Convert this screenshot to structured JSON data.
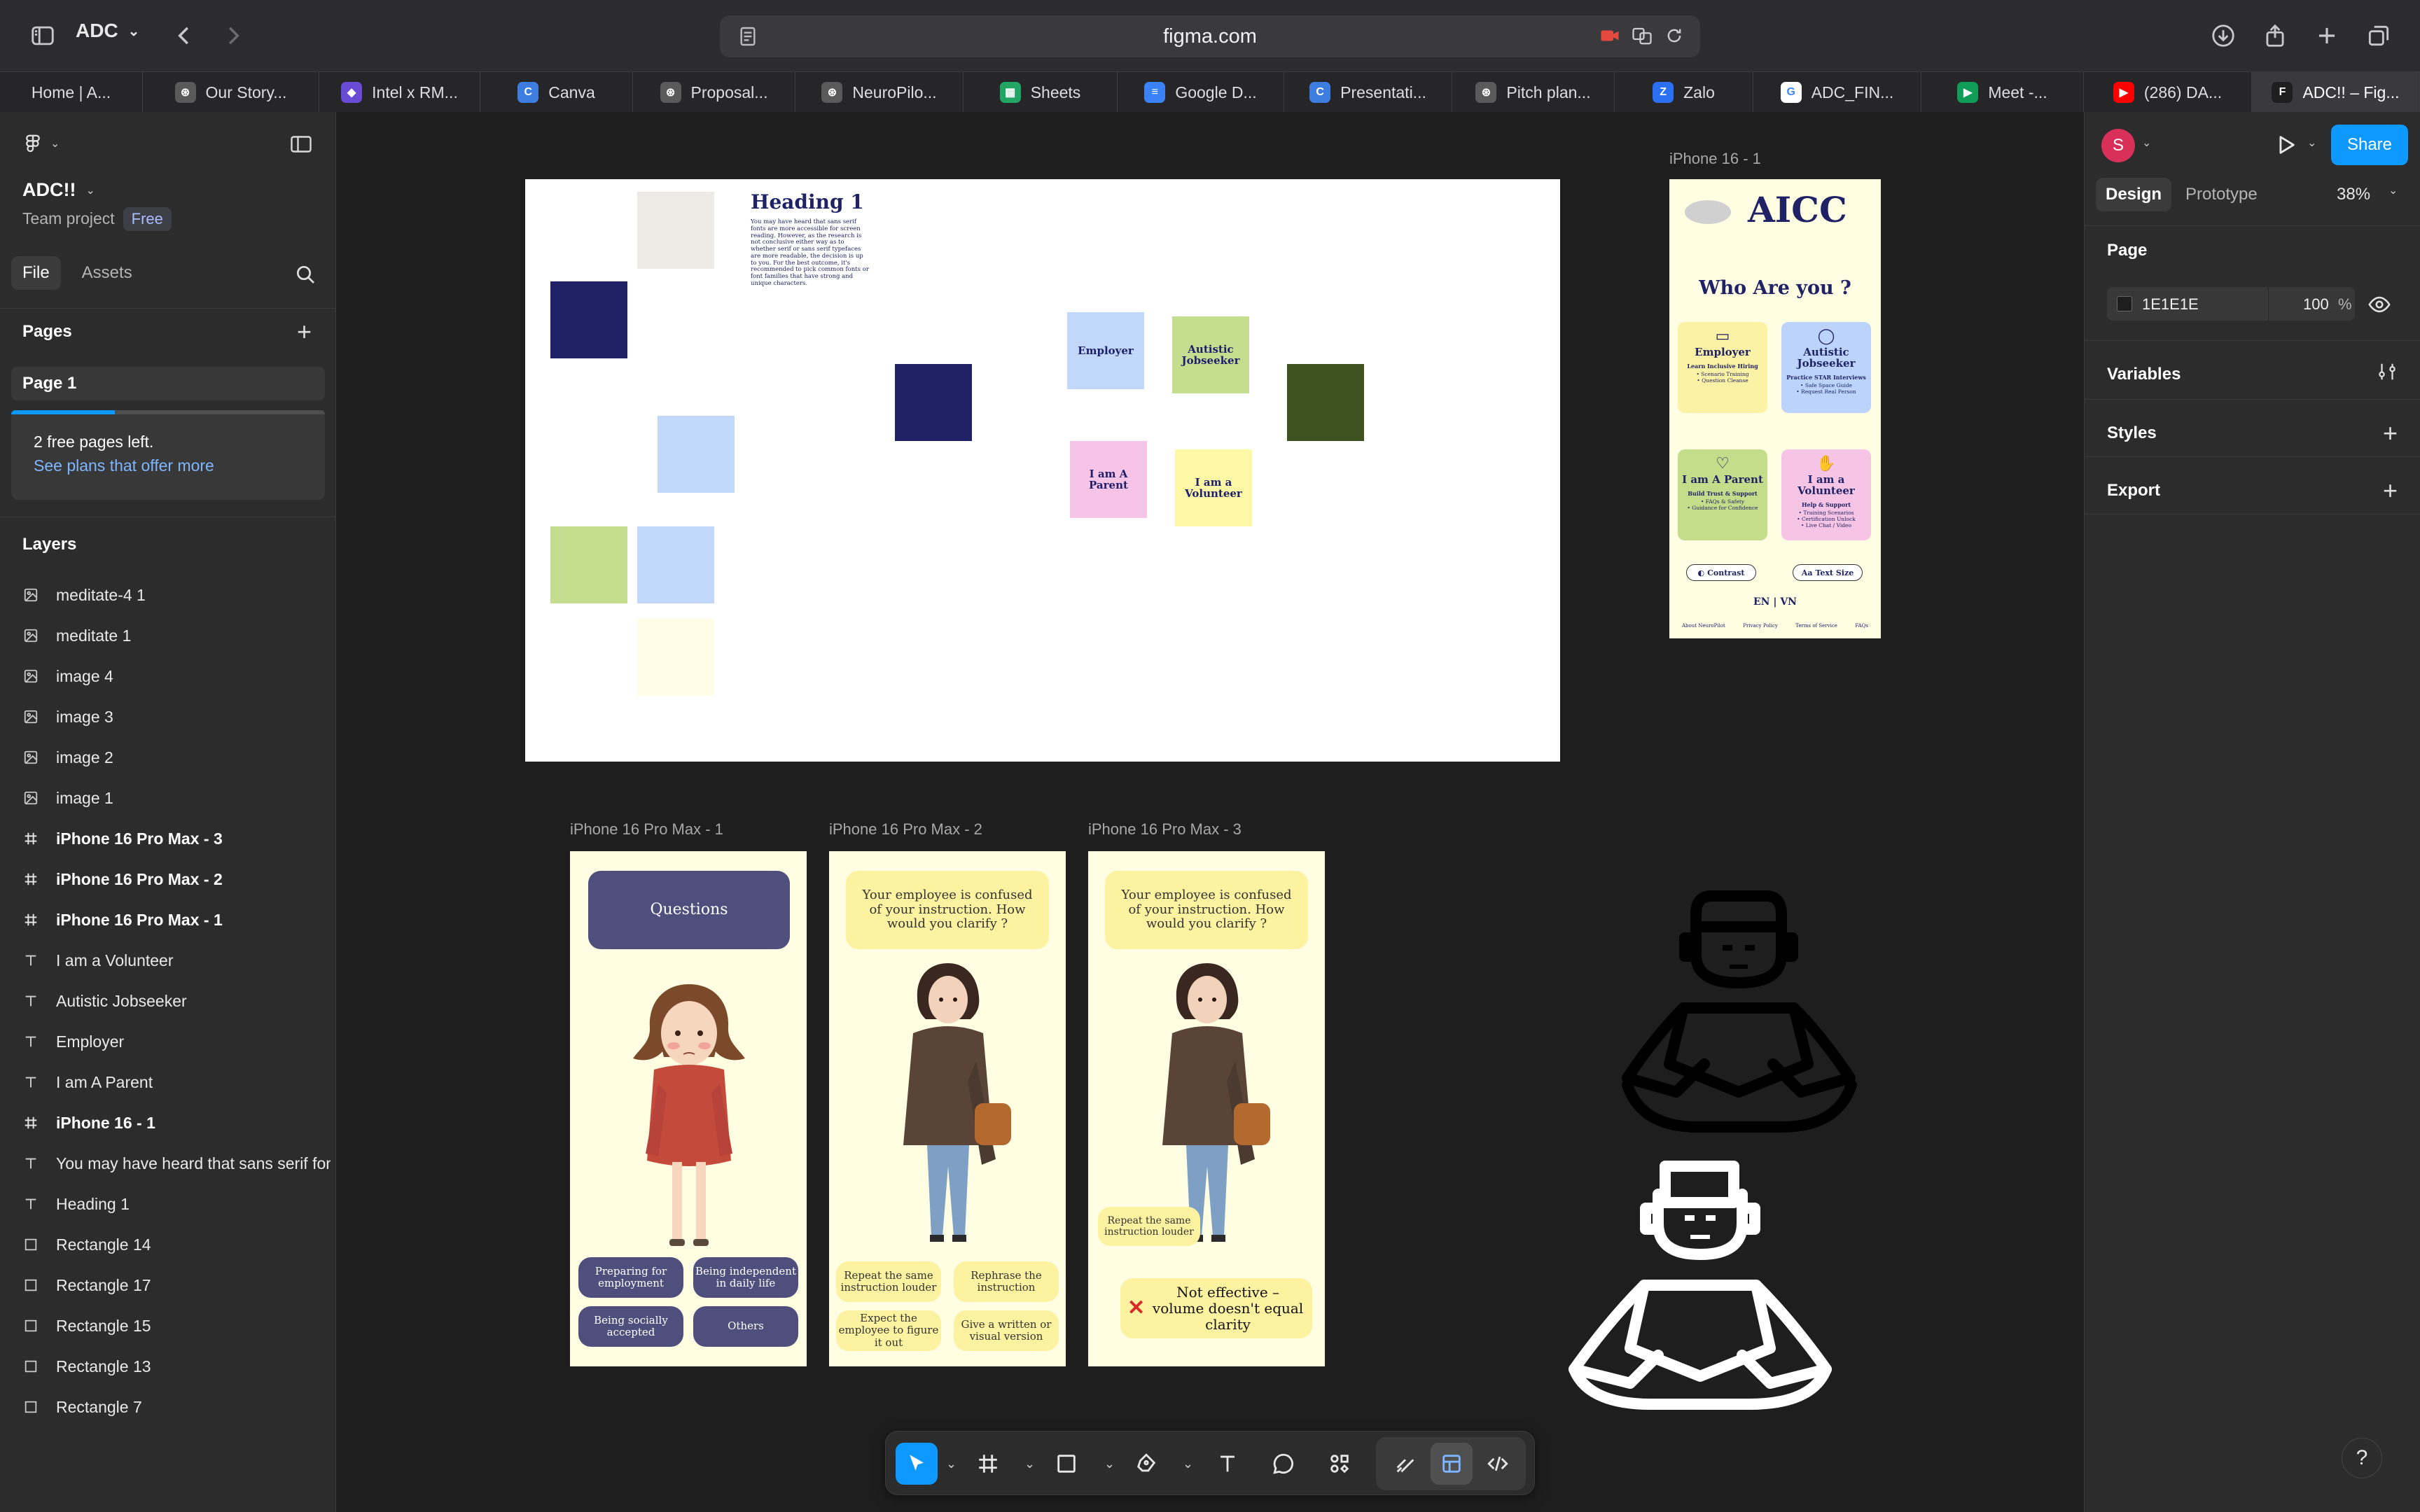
{
  "browser": {
    "profile_label": "ADC",
    "url": "figma.com",
    "tabs": [
      {
        "label": "Home | A...",
        "icon": "none",
        "color": "#3a3a3c",
        "glyph": ""
      },
      {
        "label": "Our Story...",
        "icon": "chatgpt-icon",
        "color": "#5a5a5a",
        "glyph": "⊛"
      },
      {
        "label": "Intel x RM...",
        "icon": "shield-app-icon",
        "color": "#6a4bd6",
        "glyph": "◆"
      },
      {
        "label": "Canva",
        "icon": "canva-icon",
        "color": "#3d7de0",
        "glyph": "C"
      },
      {
        "label": "Proposal...",
        "icon": "chatgpt-icon",
        "color": "#5a5a5a",
        "glyph": "⊛"
      },
      {
        "label": "NeuroPilo...",
        "icon": "chatgpt-icon",
        "color": "#5a5a5a",
        "glyph": "⊛"
      },
      {
        "label": "Sheets",
        "icon": "sheets-icon",
        "color": "#21a464",
        "glyph": "▦"
      },
      {
        "label": "Google D...",
        "icon": "docs-icon",
        "color": "#3b82f6",
        "glyph": "≡"
      },
      {
        "label": "Presentati...",
        "icon": "canva-icon",
        "color": "#3d7de0",
        "glyph": "C"
      },
      {
        "label": "Pitch plan...",
        "icon": "chatgpt-icon",
        "color": "#5a5a5a",
        "glyph": "⊛"
      },
      {
        "label": "Zalo",
        "icon": "zalo-icon",
        "color": "#2b6ff3",
        "glyph": "Z"
      },
      {
        "label": "ADC_FIN...",
        "icon": "google-icon",
        "color": "#ffffff",
        "glyph": "G"
      },
      {
        "label": "Meet -...",
        "icon": "meet-icon",
        "color": "#0f9d58",
        "glyph": "▶"
      },
      {
        "label": "(286) DA...",
        "icon": "youtube-icon",
        "color": "#ff0000",
        "glyph": "▶"
      },
      {
        "label": "ADC!! – Fig...",
        "icon": "figma-icon",
        "color": "#1e1e1e",
        "glyph": "F"
      }
    ]
  },
  "left_panel": {
    "project_name": "ADC!!",
    "team_label": "Team project",
    "plan_badge": "Free",
    "tab_file": "File",
    "tab_assets": "Assets",
    "pages_title": "Pages",
    "current_page": "Page 1",
    "free_pages_text": "2 free pages left.",
    "plans_link": "See plans that offer more",
    "free_pages_used_fraction": 0.33,
    "layers_title": "Layers",
    "layers": [
      {
        "name": "meditate-4 1",
        "type": "image",
        "glyph": "▣",
        "bold": false
      },
      {
        "name": "meditate 1",
        "type": "image",
        "glyph": "▣",
        "bold": false
      },
      {
        "name": "image 4",
        "type": "image",
        "glyph": "▣",
        "bold": false
      },
      {
        "name": "image 3",
        "type": "image",
        "glyph": "▣",
        "bold": false
      },
      {
        "name": "image 2",
        "type": "image",
        "glyph": "▣",
        "bold": false
      },
      {
        "name": "image 1",
        "type": "image",
        "glyph": "▣",
        "bold": false
      },
      {
        "name": "iPhone 16 Pro Max - 3",
        "type": "frame",
        "glyph": "#",
        "bold": true
      },
      {
        "name": "iPhone 16 Pro Max - 2",
        "type": "frame",
        "glyph": "#",
        "bold": true
      },
      {
        "name": "iPhone 16 Pro Max - 1",
        "type": "frame",
        "glyph": "#",
        "bold": true
      },
      {
        "name": "I am a Volunteer",
        "type": "text",
        "glyph": "T",
        "bold": false
      },
      {
        "name": "Autistic Jobseeker",
        "type": "text",
        "glyph": "T",
        "bold": false
      },
      {
        "name": "Employer",
        "type": "text",
        "glyph": "T",
        "bold": false
      },
      {
        "name": "I am A Parent",
        "type": "text",
        "glyph": "T",
        "bold": false
      },
      {
        "name": "iPhone 16 - 1",
        "type": "frame",
        "glyph": "#",
        "bold": true
      },
      {
        "name": "You may have heard that sans serif fon",
        "type": "text",
        "glyph": "T",
        "bold": false
      },
      {
        "name": "Heading 1",
        "type": "text",
        "glyph": "T",
        "bold": false
      },
      {
        "name": "Rectangle 14",
        "type": "rect",
        "glyph": "□",
        "bold": false
      },
      {
        "name": "Rectangle 17",
        "type": "rect",
        "glyph": "□",
        "bold": false
      },
      {
        "name": "Rectangle 15",
        "type": "rect",
        "glyph": "□",
        "bold": false
      },
      {
        "name": "Rectangle 13",
        "type": "rect",
        "glyph": "□",
        "bold": false
      },
      {
        "name": "Rectangle 7",
        "type": "rect",
        "glyph": "□",
        "bold": false
      }
    ]
  },
  "canvas": {
    "board": {
      "heading": "Heading 1",
      "paragraph": "You may have heard that sans serif fonts are more accessible for screen reading. However, as the research is not conclusive either way as to whether serif or sans serif typefaces are more readable, the decision is up to you. For the best outcome, it's recommended to pick common fonts or font families that have strong and unique characters.",
      "cards": {
        "employer": "Employer",
        "autistic": "Autistic Jobseeker",
        "parent": "I am A Parent",
        "volunteer": "I am a Volunteer"
      }
    },
    "iphone16": {
      "label": "iPhone 16 - 1",
      "logo": "AICC",
      "question": "Who Are you ?",
      "tiles": [
        {
          "title": "Employer",
          "sub": "Learn Inclusive Hiring",
          "lines": "• Scenario Training\n• Question Cleanse",
          "color": "#fbf2a5"
        },
        {
          "title": "Autistic Jobseeker",
          "sub": "Practice STAR Interviews",
          "lines": "• Safe Space Guide\n• Request Real Person",
          "color": "#bcd3fb"
        },
        {
          "title": "I am A Parent",
          "sub": "Build Trust & Support",
          "lines": "• FAQs & Safety\n• Guidance for Confidence",
          "color": "#c4dd8a"
        },
        {
          "title": "I am a Volunteer",
          "sub": "Help & Support",
          "lines": "• Training Scenarios\n• Certification Unlock\n• Live Chat / Video",
          "color": "#f6c4e4"
        }
      ],
      "contrast": "Contrast",
      "text_size": "Text Size",
      "lang": "EN | VN",
      "footer": [
        "About NeuroPilot",
        "Privacy Policy",
        "Terms of Service",
        "FAQs"
      ]
    },
    "pro1": {
      "label": "iPhone 16 Pro Max - 1",
      "header": "Questions",
      "options": [
        "Preparing for employment",
        "Being independent in daily life",
        "Being socially accepted",
        "Others"
      ]
    },
    "pro2": {
      "label": "iPhone 16 Pro Max - 2",
      "prompt": "Your employee is confused of your  instruction. How would you clarify ?",
      "options": [
        "Repeat the same instruction louder",
        "Rephrase the instruction",
        "Expect the employee to figure it out",
        "Give a written or visual version"
      ]
    },
    "pro3": {
      "label": "iPhone 16 Pro Max - 3",
      "prompt": "Your employee is confused of your  instruction. How would you clarify ?",
      "selected_option": "Repeat the same instruction louder",
      "feedback": "Not effective – volume doesn't equal clarity"
    }
  },
  "right_panel": {
    "avatar_letter": "S",
    "share": "Share",
    "tab_design": "Design",
    "tab_prototype": "Prototype",
    "zoom": "38%",
    "page_section": "Page",
    "page_color": "1E1E1E",
    "page_opacity": "100",
    "percent": "%",
    "variables": "Variables",
    "styles": "Styles",
    "export": "Export"
  },
  "colors": {
    "navy": "#1f2366",
    "light_blue": "#c2d8fb",
    "green": "#c5dd8e",
    "olive": "#3f5320",
    "cream": "#fffde6",
    "offwhite": "#edebe6",
    "employer_card": "#c2d8fb",
    "autistic_card": "#c5dd8e",
    "parent_card": "#f6c4e6",
    "volunteer_card": "#fdf8a6",
    "accent": "#0d99ff"
  }
}
